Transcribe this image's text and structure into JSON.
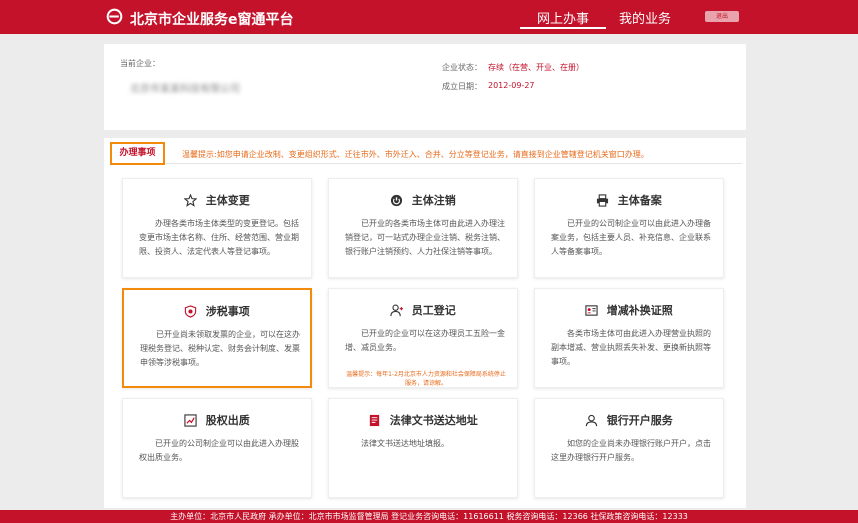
{
  "header": {
    "title": "北京市企业服务e窗通平台",
    "nav": [
      "网上办事",
      "我的业务"
    ],
    "logout_label": "退出"
  },
  "company": {
    "label": "当前企业：",
    "name": "北京市某某科技有限公司",
    "status_label": "企业状态：",
    "status_value": "存续（在营、开业、在册）",
    "date_label": "成立日期：",
    "date_value": "2012-09-27"
  },
  "tabs": {
    "active": "办理事项",
    "tip": "温馨提示:如您申请企业改制、变更组织形式、迁往市外、市外迁入、合并、分立等登记业务，请直接到企业管辖登记机关窗口办理。"
  },
  "cards": [
    {
      "title": "主体变更",
      "icon": "star-badge-icon",
      "desc": "办理各类市场主体类型的变更登记。包括变更市场主体名称、住所、经营范围、营业期限、投资人、法定代表人等登记事项。"
    },
    {
      "title": "主体注销",
      "icon": "power-icon",
      "desc": "已开业的各类市场主体可由此进入办理注销登记，可一站式办理企业注销、税务注销、银行账户注销预约、人力社保注销等事项。"
    },
    {
      "title": "主体备案",
      "icon": "printer-icon",
      "desc": "已开业的公司制企业可以由此进入办理备案业务，包括主要人员、补充信息、企业联系人等备案事项。"
    },
    {
      "title": "涉税事项",
      "icon": "tax-shield-icon",
      "desc": "已开业尚未领取发票的企业，可以在这办理税务登记、税种认定、财务会计制度、发票申领等涉税事项。"
    },
    {
      "title": "员工登记",
      "icon": "user-add-icon",
      "desc": "已开业的企业可以在这办理员工五险一金增、减员业务。",
      "note": "温馨提示：每年1-2月北京市人力资源和社会保障局系统停止服务，请谅解。"
    },
    {
      "title": "增减补换证照",
      "icon": "license-icon",
      "desc": "各类市场主体可由此进入办理营业执照的副本增减、营业执照丢失补发、更换新执照等事项。"
    },
    {
      "title": "股权出质",
      "icon": "equity-chart-icon",
      "desc": "已开业的公司制企业可以由此进入办理股权出质业务。"
    },
    {
      "title": "法律文书送达地址",
      "icon": "document-icon",
      "desc": "法律文书送达地址填报。"
    },
    {
      "title": "银行开户服务",
      "icon": "bank-user-icon",
      "desc": "如您的企业尚未办理银行账户开户，点击这里办理银行开户服务。"
    }
  ],
  "footer": {
    "text": "主办单位：北京市人民政府   承办单位：北京市市场监督管理局   登记业务咨询电话：11616611   税务咨询电话：12366   社保政策咨询电话：12333"
  },
  "colors": {
    "brand_red": "#c3122a",
    "highlight_orange": "#f28a0b",
    "tip_orange": "#e86a1a"
  }
}
